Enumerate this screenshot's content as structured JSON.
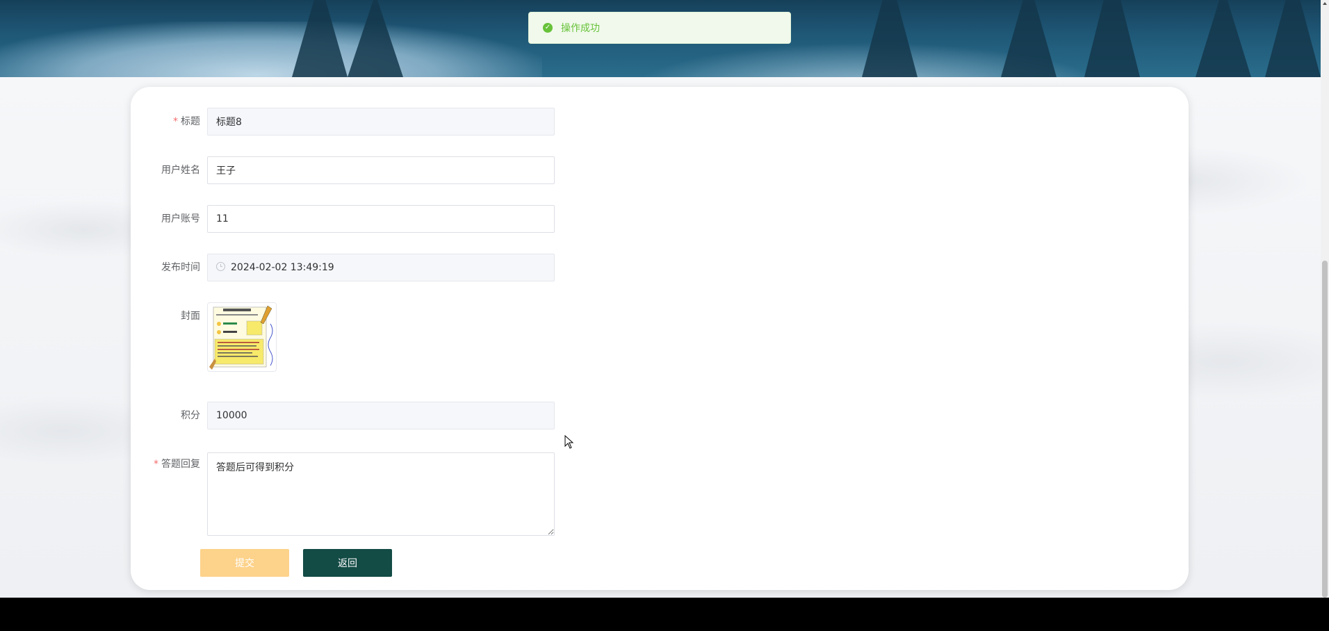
{
  "toast": {
    "message": "操作成功",
    "icon": "check-circle-icon",
    "color": "#67c23a"
  },
  "form": {
    "title": {
      "label": "标题",
      "required": true,
      "value": "标题8",
      "disabled": true
    },
    "user_name": {
      "label": "用户姓名",
      "value": "王子",
      "disabled": false
    },
    "user_account": {
      "label": "用户账号",
      "value": "11",
      "disabled": false
    },
    "publish_time": {
      "label": "发布时间",
      "value": "2024-02-02 13:49:19",
      "disabled": true
    },
    "cover": {
      "label": "封面"
    },
    "points": {
      "label": "积分",
      "value": "10000",
      "disabled": true
    },
    "answer_reply": {
      "label": "答题回复",
      "required": true,
      "value": "答题后可得到积分"
    }
  },
  "buttons": {
    "submit": "提交",
    "back": "返回"
  },
  "colors": {
    "submit_button": "#fdd28a",
    "back_button": "#134b45",
    "required_star": "#f56c6c"
  }
}
